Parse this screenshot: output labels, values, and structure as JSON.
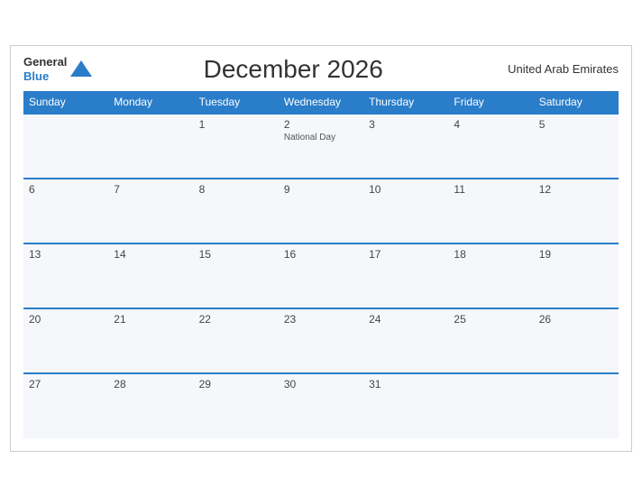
{
  "header": {
    "logo": {
      "general": "General",
      "blue": "Blue",
      "triangle_color": "#2a7dc9"
    },
    "title": "December 2026",
    "country": "United Arab Emirates"
  },
  "days_of_week": [
    "Sunday",
    "Monday",
    "Tuesday",
    "Wednesday",
    "Thursday",
    "Friday",
    "Saturday"
  ],
  "weeks": [
    [
      {
        "day": "",
        "holiday": ""
      },
      {
        "day": "",
        "holiday": ""
      },
      {
        "day": "1",
        "holiday": ""
      },
      {
        "day": "2",
        "holiday": "National Day"
      },
      {
        "day": "3",
        "holiday": ""
      },
      {
        "day": "4",
        "holiday": ""
      },
      {
        "day": "5",
        "holiday": ""
      }
    ],
    [
      {
        "day": "6",
        "holiday": ""
      },
      {
        "day": "7",
        "holiday": ""
      },
      {
        "day": "8",
        "holiday": ""
      },
      {
        "day": "9",
        "holiday": ""
      },
      {
        "day": "10",
        "holiday": ""
      },
      {
        "day": "11",
        "holiday": ""
      },
      {
        "day": "12",
        "holiday": ""
      }
    ],
    [
      {
        "day": "13",
        "holiday": ""
      },
      {
        "day": "14",
        "holiday": ""
      },
      {
        "day": "15",
        "holiday": ""
      },
      {
        "day": "16",
        "holiday": ""
      },
      {
        "day": "17",
        "holiday": ""
      },
      {
        "day": "18",
        "holiday": ""
      },
      {
        "day": "19",
        "holiday": ""
      }
    ],
    [
      {
        "day": "20",
        "holiday": ""
      },
      {
        "day": "21",
        "holiday": ""
      },
      {
        "day": "22",
        "holiday": ""
      },
      {
        "day": "23",
        "holiday": ""
      },
      {
        "day": "24",
        "holiday": ""
      },
      {
        "day": "25",
        "holiday": ""
      },
      {
        "day": "26",
        "holiday": ""
      }
    ],
    [
      {
        "day": "27",
        "holiday": ""
      },
      {
        "day": "28",
        "holiday": ""
      },
      {
        "day": "29",
        "holiday": ""
      },
      {
        "day": "30",
        "holiday": ""
      },
      {
        "day": "31",
        "holiday": ""
      },
      {
        "day": "",
        "holiday": ""
      },
      {
        "day": "",
        "holiday": ""
      }
    ]
  ]
}
